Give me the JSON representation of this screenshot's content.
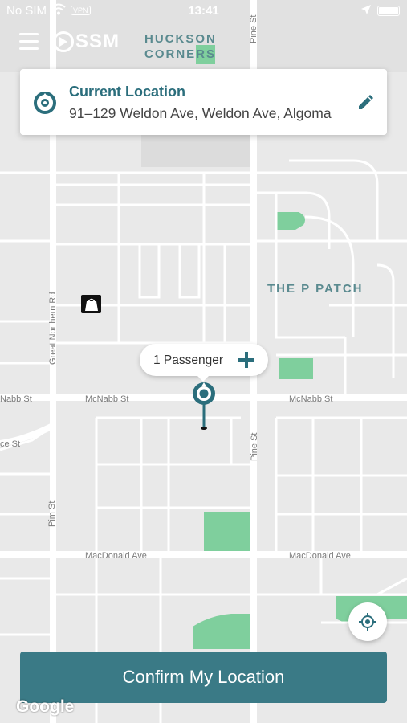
{
  "status_bar": {
    "carrier": "No SIM",
    "vpn": "VPN",
    "time": "13:41"
  },
  "header": {
    "logo_text": "SSM",
    "icons": [
      "menu-icon",
      "ssm-logo"
    ]
  },
  "location_card": {
    "title": "Current Location",
    "address": "91–129 Weldon Ave, Weldon Ave, Algoma",
    "icons": [
      "location-pin-icon",
      "edit-pencil-icon"
    ]
  },
  "passenger": {
    "label": "1 Passenger",
    "icon": "plus-icon"
  },
  "map": {
    "areas": [
      "HUCKSON",
      "CORNERS",
      "THE P PATCH"
    ],
    "streets": {
      "great_northern": "Great Northern Rd",
      "pine_top": "Pine St",
      "mcnabb_left": "McNabb St",
      "mcnabb_left_edge": "Nabb St",
      "mcnabb_right": "McNabb St",
      "pine_mid": "Pine St",
      "ce_st": "ce St",
      "pim": "Pim St",
      "macdonald_left": "MacDonald Ave",
      "macdonald_right": "MacDonald Ave"
    },
    "attribution": "Google"
  },
  "buttons": {
    "confirm": "Confirm My Location",
    "recenter_icon": "crosshair-icon"
  },
  "colors": {
    "accent": "#3a7a86",
    "accent_text": "#2b6e7c",
    "park": "#7fcf9d",
    "map_bg": "#e9e9e9",
    "road": "#ffffff"
  }
}
